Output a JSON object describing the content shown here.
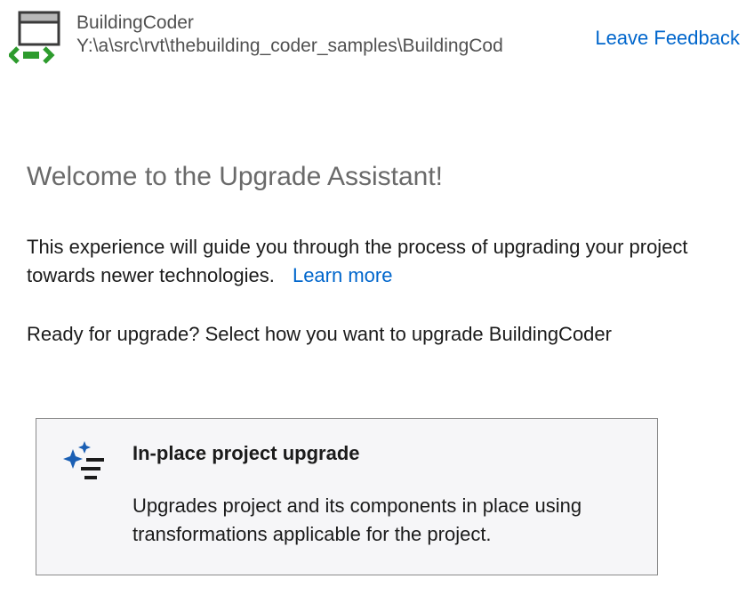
{
  "header": {
    "project_name": "BuildingCoder",
    "project_path": "Y:\\a\\src\\rvt\\thebuilding_coder_samples\\BuildingCod",
    "feedback_label": "Leave Feedback"
  },
  "content": {
    "welcome_title": "Welcome to the Upgrade Assistant!",
    "intro_text": "This experience will guide you through the process of upgrading your project towards newer technologies.",
    "learn_more_label": "Learn more",
    "ready_text": "Ready for upgrade? Select how you want to upgrade BuildingCoder"
  },
  "option": {
    "title": "In-place project upgrade",
    "description": "Upgrades project and its components in place using transformations applicable for the project."
  },
  "colors": {
    "link": "#0066cc",
    "accent_green": "#2d9b2d",
    "accent_blue": "#1a5fb4",
    "card_bg": "#f6f6f8",
    "card_border": "#8a8a8a"
  }
}
